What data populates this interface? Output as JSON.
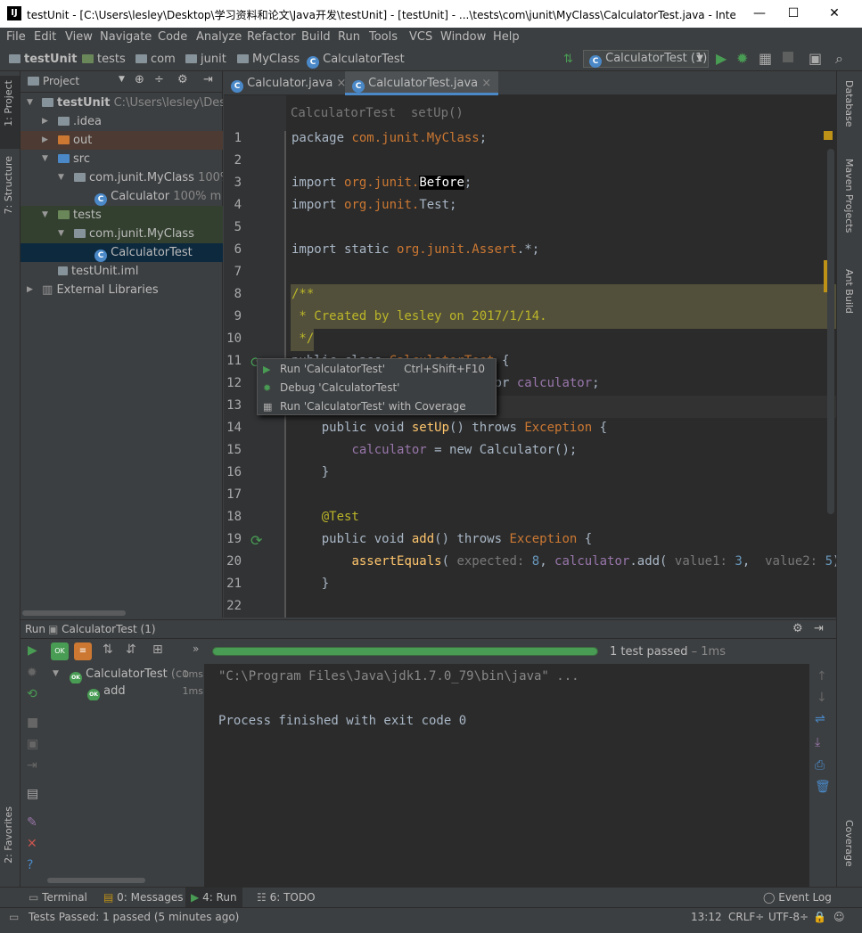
{
  "window": {
    "title": "testUnit - [C:\\Users\\lesley\\Desktop\\学习资料和论文\\Java开发\\testUnit] - [testUnit] - ...\\tests\\com\\junit\\MyClass\\CalculatorTest.java - IntelliJ IDEA",
    "app_icon": "IJ"
  },
  "menu": [
    "File",
    "Edit",
    "View",
    "Navigate",
    "Code",
    "Analyze",
    "Refactor",
    "Build",
    "Run",
    "Tools",
    "VCS",
    "Window",
    "Help"
  ],
  "breadcrumbs": [
    "testUnit",
    "tests",
    "com",
    "junit",
    "MyClass",
    "CalculatorTest"
  ],
  "run_config": "CalculatorTest (1)",
  "left_tabs": [
    "1: Project",
    "7: Structure",
    "2: Favorites"
  ],
  "right_tabs": [
    "Database",
    "Maven Projects",
    "Ant Build",
    "Coverage"
  ],
  "project": {
    "header": "Project",
    "tree": [
      {
        "label": "testUnit",
        "extra": "C:\\Users\\lesley\\Desktop"
      },
      {
        "label": ".idea"
      },
      {
        "label": "out"
      },
      {
        "label": "src"
      },
      {
        "label": "com.junit.MyClass",
        "extra": "100%"
      },
      {
        "label": "Calculator",
        "extra": "100% m"
      },
      {
        "label": "tests"
      },
      {
        "label": "com.junit.MyClass"
      },
      {
        "label": "CalculatorTest"
      },
      {
        "label": "testUnit.iml"
      },
      {
        "label": "External Libraries"
      }
    ]
  },
  "editor": {
    "tabs": [
      "Calculator.java",
      "CalculatorTest.java"
    ],
    "breadcrumb": "CalculatorTest  setUp()",
    "line_numbers": [
      "1",
      "2",
      "3",
      "4",
      "5",
      "6",
      "7",
      "8",
      "9",
      "10",
      "11",
      "12",
      "13",
      "14",
      "15",
      "16",
      "17",
      "18",
      "19",
      "20",
      "21",
      "22"
    ]
  },
  "popup": {
    "items": [
      {
        "label": "Run 'CalculatorTest'",
        "shortcut": "Ctrl+Shift+F10"
      },
      {
        "label": "Debug 'CalculatorTest'",
        "shortcut": ""
      },
      {
        "label": "Run 'CalculatorTest' with Coverage",
        "shortcut": ""
      }
    ]
  },
  "run": {
    "header_label": "Run",
    "config": "CalculatorTest (1)",
    "progress": 1.0,
    "result_text": "1 test passed",
    "result_time": "– 1ms",
    "tree": [
      {
        "label": "CalculatorTest",
        "extra": "(co",
        "time": "1ms"
      },
      {
        "label": "add",
        "time": "1ms"
      }
    ],
    "console": [
      "\"C:\\Program Files\\Java\\jdk1.7.0_79\\bin\\java\" ...",
      "",
      "Process finished with exit code 0"
    ]
  },
  "bottom_tabs": [
    "Terminal",
    "0: Messages",
    "4: Run",
    "6: TODO"
  ],
  "event_log": "Event Log",
  "status": {
    "message": "Tests Passed: 1 passed (5 minutes ago)",
    "position": "13:12",
    "line_sep": "CRLF÷",
    "encoding": "UTF-8÷"
  }
}
